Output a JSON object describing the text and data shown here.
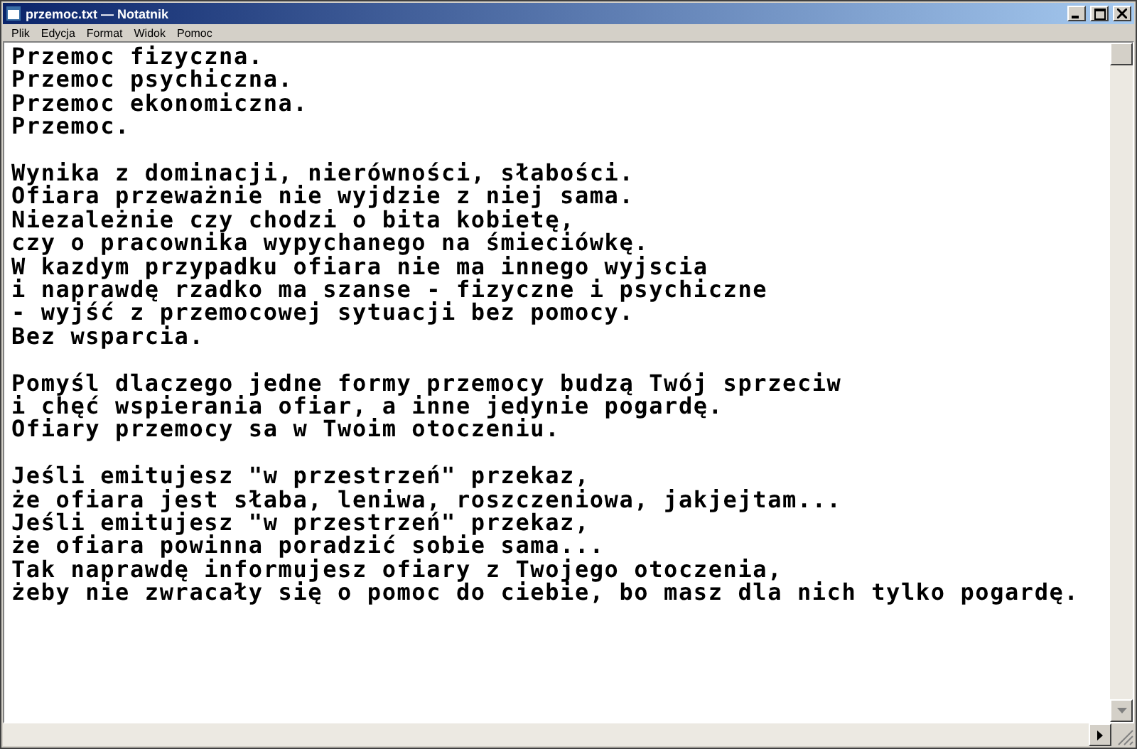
{
  "window": {
    "title": "przemoc.txt — Notatnik"
  },
  "menu": [
    "Plik",
    "Edycja",
    "Format",
    "Widok",
    "Pomoc"
  ],
  "paragraphs": [
    [
      "Przemoc fizyczna.",
      "Przemoc psychiczna.",
      "Przemoc ekonomiczna.",
      "Przemoc."
    ],
    [
      "Wynika z dominacji, nierówności, słabości.",
      "Ofiara przeważnie nie wyjdzie z niej sama.",
      "Niezależnie czy chodzi o bita kobietę,",
      "czy o pracownika wypychanego na śmieciówkę.",
      "W kazdym przypadku ofiara nie ma innego wyjscia",
      "i naprawdę rzadko ma szanse - fizyczne i psychiczne",
      "- wyjść z przemocowej sytuacji bez pomocy.",
      "Bez wsparcia."
    ],
    [
      "Pomyśl dlaczego jedne formy przemocy budzą Twój sprzeciw",
      "i chęć wspierania ofiar, a inne jedynie pogardę.",
      "Ofiary przemocy sa w Twoim otoczeniu."
    ],
    [
      "Jeśli emitujesz \"w przestrzeń\" przekaz,",
      "że ofiara jest słaba, leniwa, roszczeniowa, jakjejtam...",
      "Jeśli emitujesz \"w przestrzeń\" przekaz,",
      "że ofiara powinna poradzić sobie sama...",
      "Tak naprawdę informujesz ofiary z Twojego otoczenia,",
      "żeby nie zwracały się o pomoc do ciebie, bo masz dla nich tylko pogardę."
    ]
  ]
}
